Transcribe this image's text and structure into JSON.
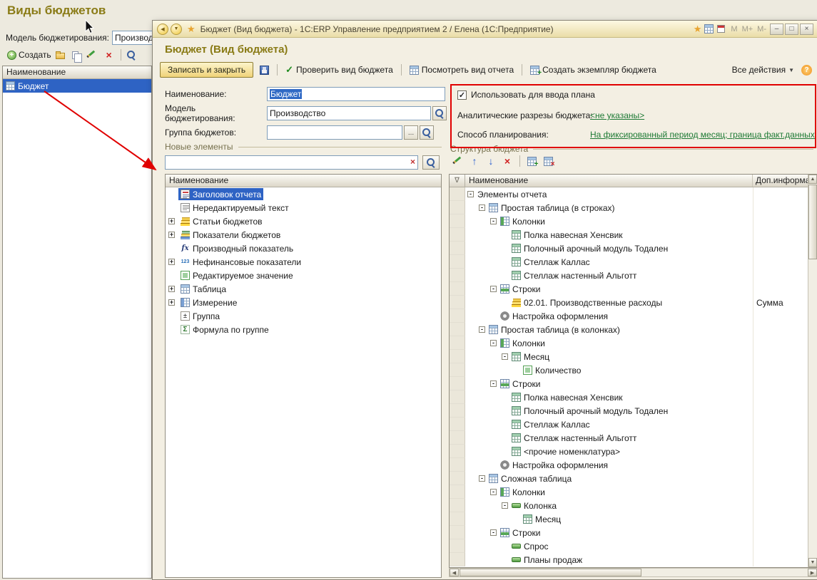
{
  "icons": {
    "check": "✓",
    "star": "★",
    "back": "◀",
    "forward": "▼",
    "dropdown": "▼",
    "minimize": "–",
    "maximize": "□",
    "close": "×",
    "filter": "∇",
    "scroll_up": "▲",
    "scroll_down": "▼",
    "scroll_left": "◀",
    "scroll_right": "▶",
    "clear": "×",
    "up_arrow": "↑",
    "down_arrow": "↓",
    "delete": "×"
  },
  "background_window": {
    "page_title": "Виды бюджетов",
    "model_label": "Модель бюджетирования:",
    "model_value": "Производст",
    "create_button": "Создать",
    "list_header": "Наименование",
    "items": [
      {
        "icon": "table",
        "label": "Бюджет",
        "selected": true
      }
    ]
  },
  "window": {
    "titlebar": {
      "title": "Бюджет (Вид бюджета) - 1С:ERP Управление предприятием 2 / Елена  (1С:Предприятие)",
      "memory_buttons": [
        "M",
        "M+",
        "M-"
      ]
    },
    "page_title": "Бюджет (Вид бюджета)",
    "toolbar": {
      "save_and_close": "Записать и закрыть",
      "check_view": "Проверить вид бюджета",
      "view_report": "Посмотреть вид отчета",
      "create_instance": "Создать экземпляр бюджета",
      "all_actions": "Все действия",
      "help": "?"
    },
    "form": {
      "name_label": "Наименование:",
      "name_value": "Бюджет",
      "model_label": "Модель бюджетирования:",
      "model_value": "Производство",
      "group_label": "Группа бюджетов:",
      "group_value": "",
      "ellipsis": "..."
    },
    "plan_panel": {
      "use_plan_checkbox": "Использовать для ввода плана",
      "analytics_label": "Аналитические разрезы бюджета:",
      "analytics_link": "<не указаны>",
      "planning_label": "Способ планирования:",
      "planning_link": "На фиксированный период месяц;  граница факт.данных внутр..."
    },
    "new_elements": {
      "group_title": "Новые элементы",
      "search_value": "",
      "list_header": "Наименование",
      "items": [
        {
          "icon": "report-title",
          "label": "Заголовок отчета",
          "selected": true
        },
        {
          "icon": "static-text",
          "label": "Нередактируемый текст"
        },
        {
          "expand": true,
          "icon": "budget-articles",
          "label": "Статьи бюджетов"
        },
        {
          "expand": true,
          "icon": "budget-indicators",
          "label": "Показатели бюджетов"
        },
        {
          "icon": "derived-indicator",
          "label": "Производный показатель"
        },
        {
          "expand": true,
          "icon": "nonfinancial",
          "label": "Нефинансовые показатели"
        },
        {
          "icon": "editable-value",
          "label": "Редактируемое значение"
        },
        {
          "expand": true,
          "icon": "table",
          "label": "Таблица"
        },
        {
          "expand": true,
          "icon": "dimension",
          "label": "Измерение"
        },
        {
          "icon": "group",
          "label": "Группа"
        },
        {
          "icon": "formula",
          "label": "Формула по группе"
        }
      ]
    },
    "structure": {
      "group_title": "Структура бюджета",
      "col_name": "Наименование",
      "col_info": "Доп.информац",
      "rows": [
        {
          "level": 0,
          "expanded": true,
          "label": "Элементы отчета"
        },
        {
          "level": 1,
          "expanded": true,
          "icon": "table",
          "label": "Простая таблица (в строках)"
        },
        {
          "level": 2,
          "expanded": true,
          "icon": "columns",
          "label": "Колонки"
        },
        {
          "level": 3,
          "icon": "grid",
          "label": "Полка навесная Хенсвик"
        },
        {
          "level": 3,
          "icon": "grid",
          "label": "Полочный арочный модуль Тодален"
        },
        {
          "level": 3,
          "icon": "grid",
          "label": "Стеллаж Каллас"
        },
        {
          "level": 3,
          "icon": "grid",
          "label": "Стеллаж настенный Альготт"
        },
        {
          "level": 2,
          "expanded": true,
          "icon": "rows",
          "label": "Строки"
        },
        {
          "level": 3,
          "icon": "budget-articles",
          "label": "02.01. Производственные расходы",
          "info": "Сумма"
        },
        {
          "level": 2,
          "icon": "gear",
          "label": "Настройка оформления"
        },
        {
          "level": 1,
          "expanded": true,
          "icon": "table",
          "label": "Простая таблица (в колонках)"
        },
        {
          "level": 2,
          "expanded": true,
          "icon": "columns",
          "label": "Колонки"
        },
        {
          "level": 3,
          "expanded": true,
          "icon": "grid",
          "label": "Месяц"
        },
        {
          "level": 4,
          "icon": "editable-value",
          "label": "Количество"
        },
        {
          "level": 2,
          "expanded": true,
          "icon": "rows",
          "label": "Строки"
        },
        {
          "level": 3,
          "icon": "grid",
          "label": "Полка навесная Хенсвик"
        },
        {
          "level": 3,
          "icon": "grid",
          "label": "Полочный арочный модуль Тодален"
        },
        {
          "level": 3,
          "icon": "grid",
          "label": "Стеллаж Каллас"
        },
        {
          "level": 3,
          "icon": "grid",
          "label": "Стеллаж настенный Альготт"
        },
        {
          "level": 3,
          "icon": "grid",
          "label": "<прочие номенклатура>"
        },
        {
          "level": 2,
          "icon": "gear",
          "label": "Настройка оформления"
        },
        {
          "level": 1,
          "expanded": true,
          "icon": "table",
          "label": "Сложная таблица"
        },
        {
          "level": 2,
          "expanded": true,
          "icon": "columns",
          "label": "Колонки"
        },
        {
          "level": 3,
          "expanded": true,
          "icon": "column",
          "label": "Колонка"
        },
        {
          "level": 4,
          "icon": "grid",
          "label": "Месяц"
        },
        {
          "level": 2,
          "expanded": true,
          "icon": "rows",
          "label": "Строки"
        },
        {
          "level": 3,
          "icon": "column",
          "label": "Спрос"
        },
        {
          "level": 3,
          "icon": "column",
          "label": "Планы продаж"
        }
      ]
    }
  }
}
